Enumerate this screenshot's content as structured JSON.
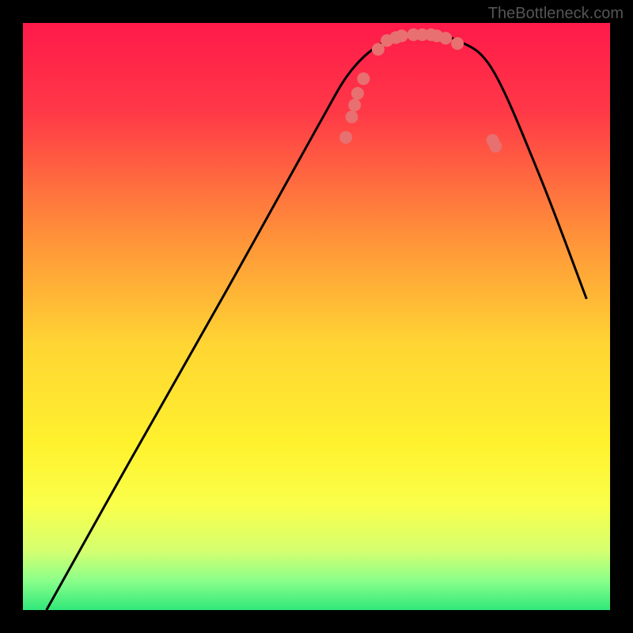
{
  "watermark": "TheBottleneck.com",
  "chart_data": {
    "type": "line",
    "title": "",
    "xlabel": "",
    "ylabel": "",
    "x_range": [
      0,
      100
    ],
    "y_range": [
      0,
      100
    ],
    "curve": {
      "name": "bottleneck-curve",
      "points": [
        {
          "x": 4,
          "y": 0
        },
        {
          "x": 18,
          "y": 25
        },
        {
          "x": 35,
          "y": 55
        },
        {
          "x": 50,
          "y": 82
        },
        {
          "x": 56,
          "y": 92
        },
        {
          "x": 62,
          "y": 97
        },
        {
          "x": 68,
          "y": 98
        },
        {
          "x": 74,
          "y": 97
        },
        {
          "x": 80,
          "y": 92
        },
        {
          "x": 88,
          "y": 74
        },
        {
          "x": 96,
          "y": 53
        }
      ]
    },
    "dots": [
      {
        "x": 55.0,
        "y": 80.5
      },
      {
        "x": 56.0,
        "y": 84.0
      },
      {
        "x": 56.5,
        "y": 86.0
      },
      {
        "x": 57.0,
        "y": 88.0
      },
      {
        "x": 58.0,
        "y": 90.5
      },
      {
        "x": 60.5,
        "y": 95.5
      },
      {
        "x": 62.0,
        "y": 97.0
      },
      {
        "x": 63.5,
        "y": 97.5
      },
      {
        "x": 64.5,
        "y": 97.8
      },
      {
        "x": 66.5,
        "y": 98.0
      },
      {
        "x": 68.0,
        "y": 98.0
      },
      {
        "x": 69.5,
        "y": 98.0
      },
      {
        "x": 70.5,
        "y": 97.8
      },
      {
        "x": 72.0,
        "y": 97.4
      },
      {
        "x": 74.0,
        "y": 96.5
      },
      {
        "x": 80.0,
        "y": 80.0
      },
      {
        "x": 80.5,
        "y": 79.0
      }
    ],
    "gradient_stops": [
      {
        "offset": 0,
        "color": "#ff1a4a"
      },
      {
        "offset": 0.15,
        "color": "#ff3847"
      },
      {
        "offset": 0.35,
        "color": "#ff8c3a"
      },
      {
        "offset": 0.55,
        "color": "#ffd633"
      },
      {
        "offset": 0.72,
        "color": "#fff22e"
      },
      {
        "offset": 0.82,
        "color": "#faff4a"
      },
      {
        "offset": 0.9,
        "color": "#d4ff70"
      },
      {
        "offset": 0.95,
        "color": "#8aff8a"
      },
      {
        "offset": 1.0,
        "color": "#30e87a"
      }
    ],
    "dot_color": "#e87070",
    "curve_color": "#000000"
  }
}
